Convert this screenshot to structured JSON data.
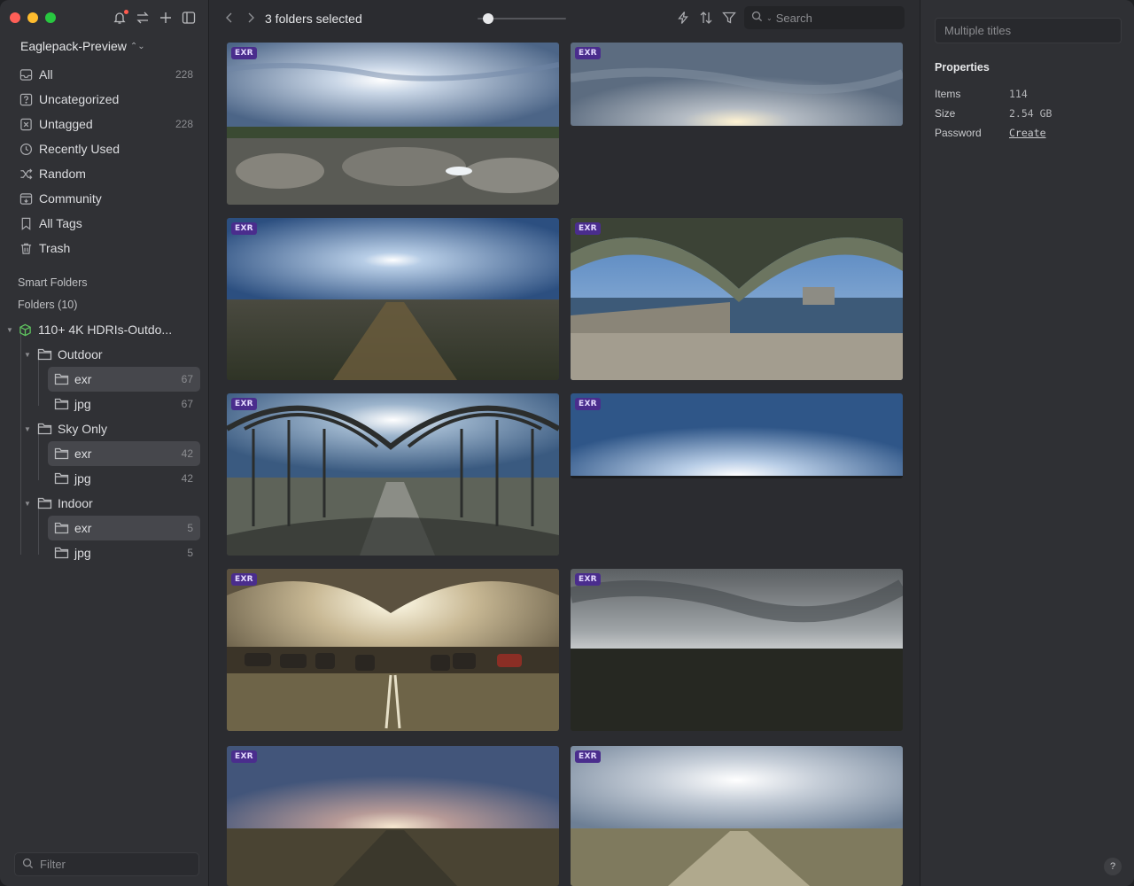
{
  "sidebar": {
    "library_name": "Eaglepack-Preview",
    "nav": [
      {
        "label": "All",
        "count": "228",
        "icon": "inbox-icon"
      },
      {
        "label": "Uncategorized",
        "count": "",
        "icon": "question-icon"
      },
      {
        "label": "Untagged",
        "count": "228",
        "icon": "untagged-icon"
      },
      {
        "label": "Recently Used",
        "count": "",
        "icon": "clock-icon"
      },
      {
        "label": "Random",
        "count": "",
        "icon": "shuffle-icon"
      },
      {
        "label": "Community",
        "count": "",
        "icon": "community-icon"
      },
      {
        "label": "All Tags",
        "count": "",
        "icon": "bookmark-icon"
      },
      {
        "label": "Trash",
        "count": "",
        "icon": "trash-icon"
      }
    ],
    "smart_folders_label": "Smart Folders",
    "folders_label": "Folders (10)",
    "tree": {
      "root": "110+ 4K HDRIs-Outdo...",
      "groups": [
        {
          "name": "Outdoor",
          "children": [
            {
              "name": "exr",
              "count": "67",
              "selected": true
            },
            {
              "name": "jpg",
              "count": "67",
              "selected": false
            }
          ]
        },
        {
          "name": "Sky Only",
          "children": [
            {
              "name": "exr",
              "count": "42",
              "selected": true
            },
            {
              "name": "jpg",
              "count": "42",
              "selected": false
            }
          ]
        },
        {
          "name": "Indoor",
          "children": [
            {
              "name": "exr",
              "count": "5",
              "selected": true
            },
            {
              "name": "jpg",
              "count": "5",
              "selected": false
            }
          ]
        }
      ]
    },
    "filter_placeholder": "Filter"
  },
  "toolbar": {
    "title": "3 folders selected",
    "search_placeholder": "Search",
    "zoom_level": 0.12
  },
  "grid": {
    "badge": "EXR",
    "items": [
      {
        "scene": "rocky-hill"
      },
      {
        "scene": "cloudy-sky"
      },
      {
        "scene": "field-path"
      },
      {
        "scene": "bridge-river"
      },
      {
        "scene": "pergola-park"
      },
      {
        "scene": "blue-sky"
      },
      {
        "scene": "parking-garage"
      },
      {
        "scene": "overcast-field"
      },
      {
        "scene": "dusk-field"
      },
      {
        "scene": "bright-field"
      }
    ]
  },
  "inspector": {
    "title_placeholder": "Multiple titles",
    "properties_label": "Properties",
    "rows": [
      {
        "key": "Items",
        "value": "114"
      },
      {
        "key": "Size",
        "value": "2.54 GB"
      },
      {
        "key": "Password",
        "value": "Create"
      }
    ],
    "help_label": "?"
  },
  "colors": {
    "accent_badge": "#4a2d8d",
    "folder_root": "#5fc35f"
  }
}
